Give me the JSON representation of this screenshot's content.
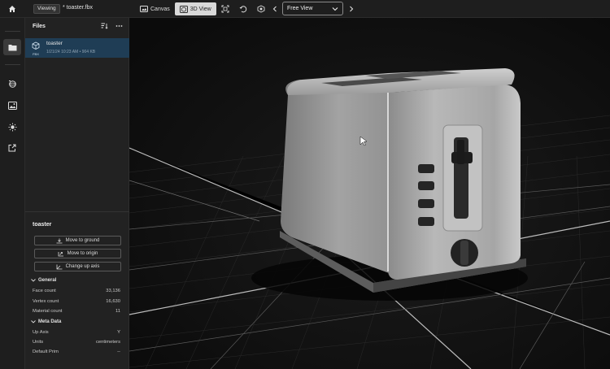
{
  "topbar": {
    "viewing_label": "Viewing",
    "file_title": "* toaster.fbx",
    "canvas_label": "Canvas",
    "view3d_label": "3D View",
    "view_select_value": "Free View"
  },
  "panel": {
    "title": "Files",
    "file": {
      "name": "toaster",
      "type_tag": "FBX",
      "meta": "1/21/24 10:23 AM • 904 KB"
    }
  },
  "properties": {
    "object_name": "toaster",
    "actions": [
      "Move to ground",
      "Move to origin",
      "Change up axis"
    ],
    "general": {
      "title": "General",
      "rows": [
        {
          "label": "Face count",
          "value": "33,136"
        },
        {
          "label": "Vertex count",
          "value": "16,630"
        },
        {
          "label": "Material count",
          "value": "11"
        }
      ]
    },
    "meta": {
      "title": "Meta Data",
      "rows": [
        {
          "label": "Up Axis",
          "value": "Y"
        },
        {
          "label": "Units",
          "value": "centimeters"
        },
        {
          "label": "Default Prim",
          "value": "--"
        }
      ]
    }
  },
  "colors": {
    "accent_selection": "#1f3d55",
    "background": "#1b1b1b",
    "viewport": "#0f0f0f"
  },
  "icons": [
    "home-icon",
    "canvas-icon",
    "cube-view-icon",
    "frame-icon",
    "reset-icon",
    "render-icon",
    "chevron-left-icon",
    "chevron-down-icon",
    "chevron-right-icon",
    "folder-icon",
    "materials-icon",
    "image-icon",
    "light-icon",
    "export-icon",
    "sort-icon",
    "more-icon",
    "cube-file-icon"
  ]
}
